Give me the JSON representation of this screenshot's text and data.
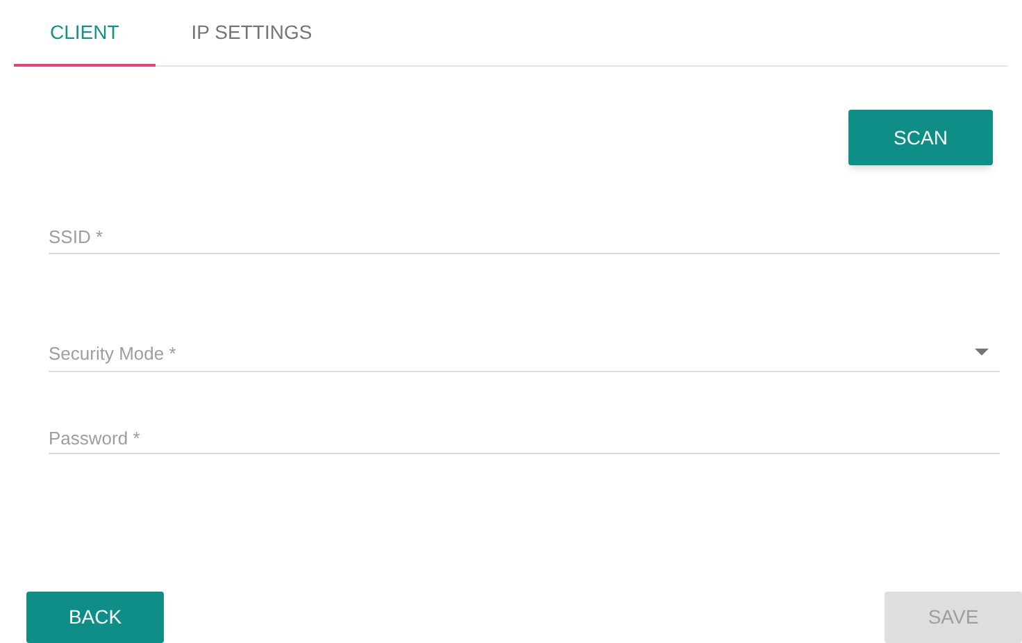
{
  "tabs": [
    {
      "label": "CLIENT",
      "selected": true
    },
    {
      "label": "IP SETTINGS",
      "selected": false
    }
  ],
  "scan_button": {
    "label": "SCAN"
  },
  "fields": [
    {
      "kind": "text",
      "placeholder": "SSID *"
    },
    {
      "kind": "select",
      "placeholder": "Security Mode *"
    },
    {
      "kind": "password",
      "placeholder": "Password *"
    }
  ],
  "buttons": [
    {
      "label": "BACK",
      "disabled": false
    },
    {
      "label": "SAVE",
      "disabled": true
    }
  ]
}
